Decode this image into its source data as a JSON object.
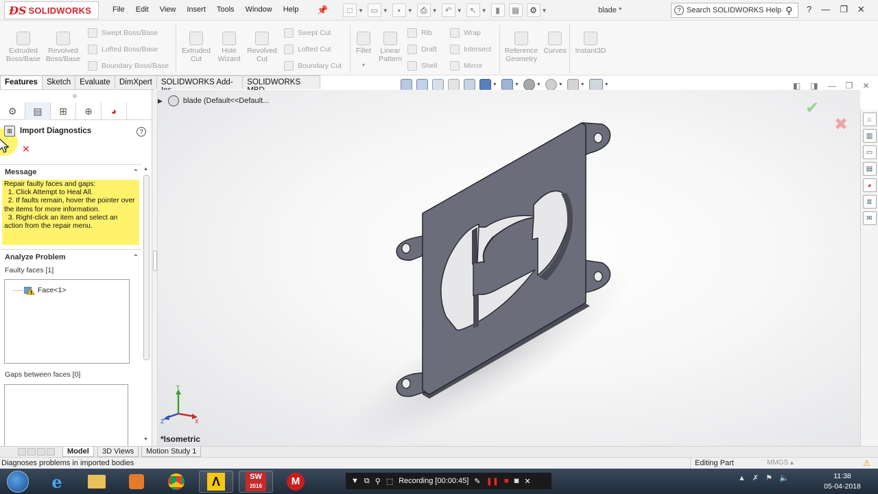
{
  "app": {
    "brand": "SOLIDWORKS",
    "document_title": "blade *",
    "search_placeholder": "Search SOLIDWORKS Help"
  },
  "menus": [
    "File",
    "Edit",
    "View",
    "Insert",
    "Tools",
    "Window",
    "Help"
  ],
  "command_manager": {
    "large_buttons": [
      {
        "label_line1": "Extruded",
        "label_line2": "Boss/Base"
      },
      {
        "label_line1": "Revolved",
        "label_line2": "Boss/Base"
      },
      {
        "label_line1": "Extruded",
        "label_line2": "Cut"
      },
      {
        "label_line1": "Hole",
        "label_line2": "Wizard"
      },
      {
        "label_line1": "Revolved",
        "label_line2": "Cut"
      },
      {
        "label_line1": "Fillet",
        "label_line2": ""
      },
      {
        "label_line1": "Linear",
        "label_line2": "Pattern"
      },
      {
        "label_line1": "Reference",
        "label_line2": "Geometry"
      },
      {
        "label_line1": "Curves",
        "label_line2": ""
      },
      {
        "label_line1": "Instant3D",
        "label_line2": ""
      }
    ],
    "small_buttons": {
      "swept_boss": "Swept Boss/Base",
      "lofted_boss": "Lofted Boss/Base",
      "boundary_boss": "Boundary Boss/Base",
      "swept_cut": "Swept Cut",
      "lofted_cut": "Lofted Cut",
      "boundary_cut": "Boundary Cut",
      "rib": "Rib",
      "draft": "Draft",
      "shell": "Shell",
      "wrap": "Wrap",
      "intersect": "Intersect",
      "mirror": "Mirror"
    }
  },
  "tabs": [
    "Features",
    "Sketch",
    "Evaluate",
    "DimXpert",
    "SOLIDWORKS Add-Ins",
    "SOLIDWORKS MBD"
  ],
  "property_manager": {
    "title": "Import Diagnostics",
    "message_header": "Message",
    "message_text": "Repair faulty faces and gaps:\n  1. Click Attempt to Heal All.\n  2. If faults remain, hover the pointer over the items for more information.\n  3. Right-click an item and select an action from the repair menu.",
    "analyze_header": "Analyze Problem",
    "faulty_faces_label": "Faulty faces [1]",
    "faulty_faces": [
      "Face<1>"
    ],
    "gaps_label": "Gaps between faces [0]"
  },
  "graphics": {
    "tree_item": "blade  (Default<<Default...",
    "view_label": "*Isometric",
    "model_color": "#6b6d7a"
  },
  "bottom_tabs": [
    "Model",
    "3D Views",
    "Motion Study 1"
  ],
  "status": {
    "hint": "Diagnoses problems in imported bodies",
    "mode": "Editing Part",
    "units": "MMGS"
  },
  "taskbar": {
    "recording": "Recording [00:00:45]",
    "time": "11:38",
    "date": "05-04-2018",
    "sw_badge": "2016"
  }
}
